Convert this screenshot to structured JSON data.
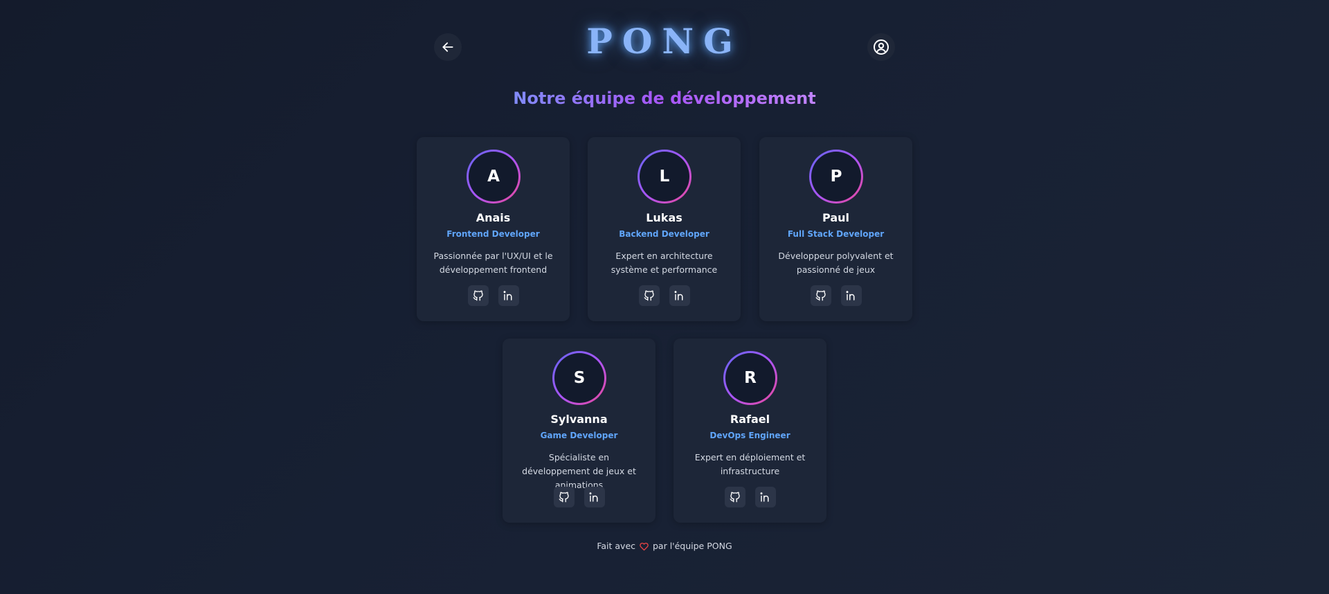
{
  "header": {
    "logo": "PONG",
    "back_icon": "arrow-left-icon",
    "profile_icon": "user-circle-icon"
  },
  "section": {
    "title": "Notre équipe de développement"
  },
  "team": [
    {
      "initial": "A",
      "name": "Anais",
      "role": "Frontend Developer",
      "description": "Passionnée par l'UX/UI et le développement frontend",
      "socials": [
        "github-icon",
        "linkedin-icon"
      ]
    },
    {
      "initial": "L",
      "name": "Lukas",
      "role": "Backend Developer",
      "description": "Expert en architecture système et performance",
      "socials": [
        "github-icon",
        "linkedin-icon"
      ]
    },
    {
      "initial": "P",
      "name": "Paul",
      "role": "Full Stack Developer",
      "description": "Développeur polyvalent et passionné de jeux",
      "socials": [
        "github-icon",
        "linkedin-icon"
      ]
    },
    {
      "initial": "S",
      "name": "Sylvanna",
      "role": "Game Developer",
      "description": "Spécialiste en développement de jeux et animations",
      "socials": [
        "github-icon",
        "linkedin-icon"
      ]
    },
    {
      "initial": "R",
      "name": "Rafael",
      "role": "DevOps Engineer",
      "description": "Expert en déploiement et infrastructure",
      "socials": [
        "github-icon",
        "linkedin-icon"
      ]
    }
  ],
  "footer": {
    "before": "Fait avec",
    "after": "par l'équipe PONG",
    "heart_icon": "heart-icon"
  },
  "colors": {
    "accent_blue": "#60a5fa",
    "logo_glow": "#8ab4f8",
    "gradient_start": "#6366f1",
    "gradient_end": "#ec4899",
    "heart": "#ef4444"
  }
}
